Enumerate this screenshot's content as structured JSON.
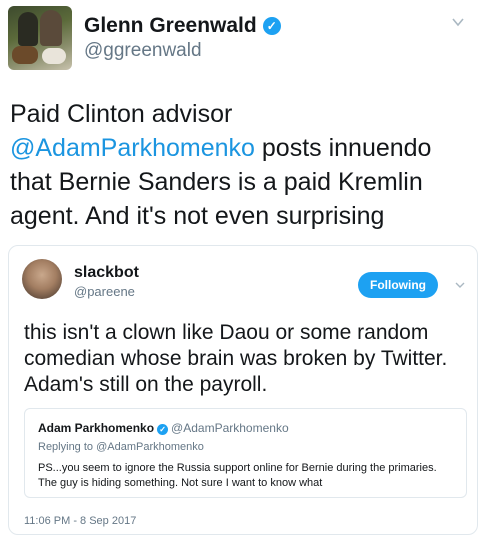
{
  "tweet": {
    "author_name": "Glenn Greenwald",
    "author_handle": "@ggreenwald",
    "text_before": "Paid Clinton advisor ",
    "mention": "@AdamParkhomenko",
    "text_after": " posts innuendo that Bernie Sanders is a paid Kremlin agent. And it's not even surprising"
  },
  "quoted": {
    "author_name": "slackbot",
    "author_handle": "@pareene",
    "follow_label": "Following",
    "text": "this isn't a clown like Daou or some random comedian whose brain was broken by Twitter. Adam's still on the payroll.",
    "timestamp": "11:06 PM - 8 Sep 2017"
  },
  "nested": {
    "author_name": "Adam Parkhomenko",
    "author_handle": "@AdamParkhomenko",
    "reply_prefix": "Replying to ",
    "reply_handle": "@AdamParkhomenko",
    "text": "PS...you seem to ignore the Russia support online for Bernie during the primaries. The guy is hiding something. Not sure I want to know what"
  },
  "icons": {
    "verified": "✓",
    "chevron": "chevron-down-icon"
  },
  "colors": {
    "accent": "#1da1f2",
    "link": "#1b95e0",
    "muted": "#657786"
  }
}
